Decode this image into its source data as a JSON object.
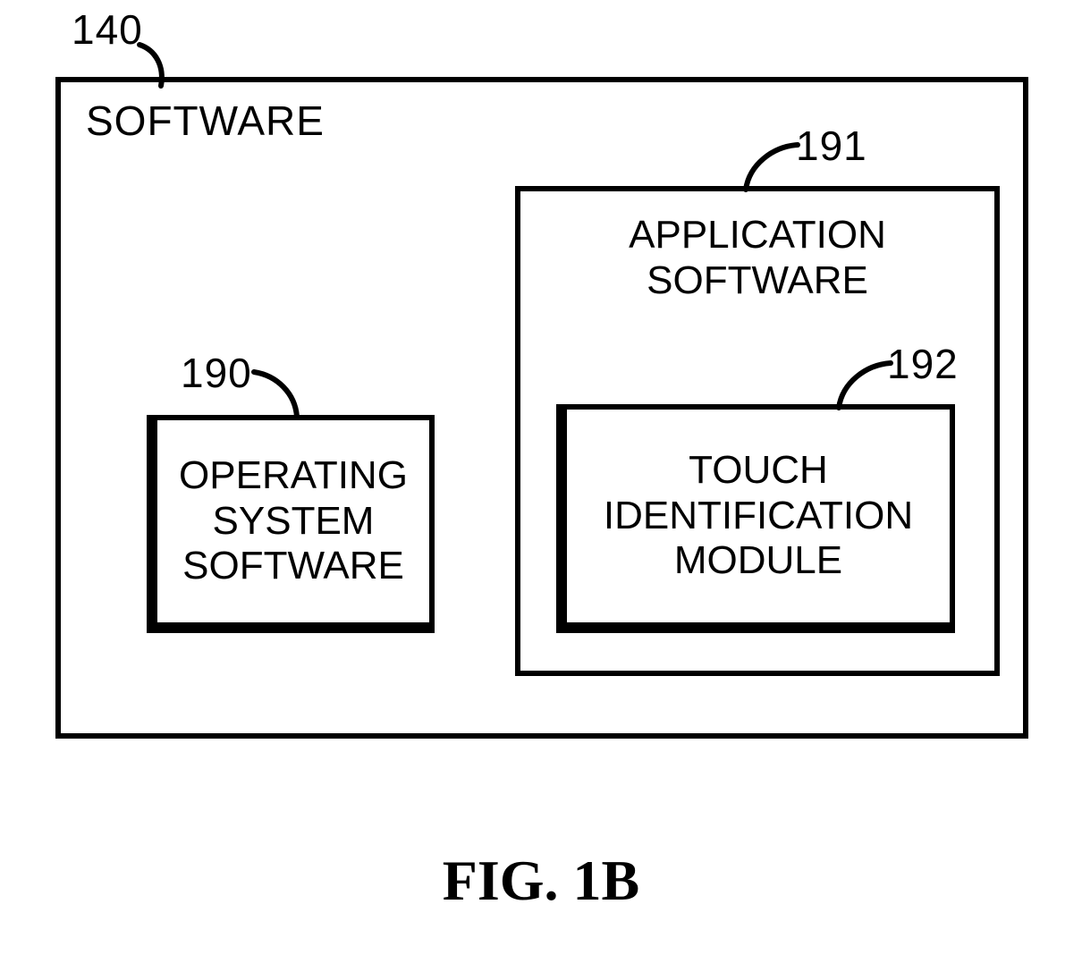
{
  "refs": {
    "outer": "140",
    "os": "190",
    "app": "191",
    "touch": "192"
  },
  "labels": {
    "outer_title": "SOFTWARE",
    "os_box": "OPERATING\nSYSTEM\nSOFTWARE",
    "app_box_title": "APPLICATION\nSOFTWARE",
    "touch_box": "TOUCH\nIDENTIFICATION\nMODULE"
  },
  "caption": "FIG. 1B"
}
